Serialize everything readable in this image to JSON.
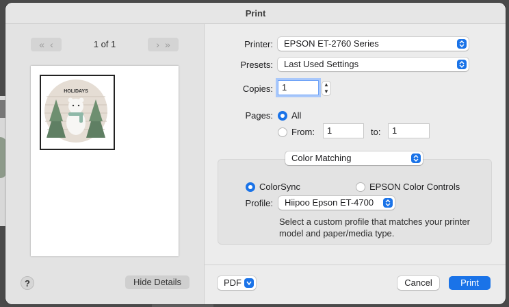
{
  "dialog": {
    "title": "Print"
  },
  "preview": {
    "page_count": "1 of 1",
    "thumbnail_text": "HOLIDAYS"
  },
  "printer": {
    "label": "Printer:",
    "value": "EPSON ET-2760 Series"
  },
  "presets": {
    "label": "Presets:",
    "value": "Last Used Settings"
  },
  "copies": {
    "label": "Copies:",
    "value": "1"
  },
  "pages": {
    "label": "Pages:",
    "all_label": "All",
    "from_label": "From:",
    "from_value": "1",
    "to_label": "to:",
    "to_value": "1"
  },
  "section": {
    "value": "Color Matching"
  },
  "color_matching": {
    "colorsync_label": "ColorSync",
    "epson_label": "EPSON Color Controls",
    "profile_label": "Profile:",
    "profile_value": "Hiipoo Epson ET-4700",
    "description": "Select a custom profile that matches your printer model and paper/media type."
  },
  "footer": {
    "help_label": "?",
    "hide_details_label": "Hide Details",
    "pdf_label": "PDF",
    "cancel_label": "Cancel",
    "print_label": "Print"
  },
  "colors": {
    "accent": "#1a73e8",
    "dialog_bg": "#ececec"
  }
}
